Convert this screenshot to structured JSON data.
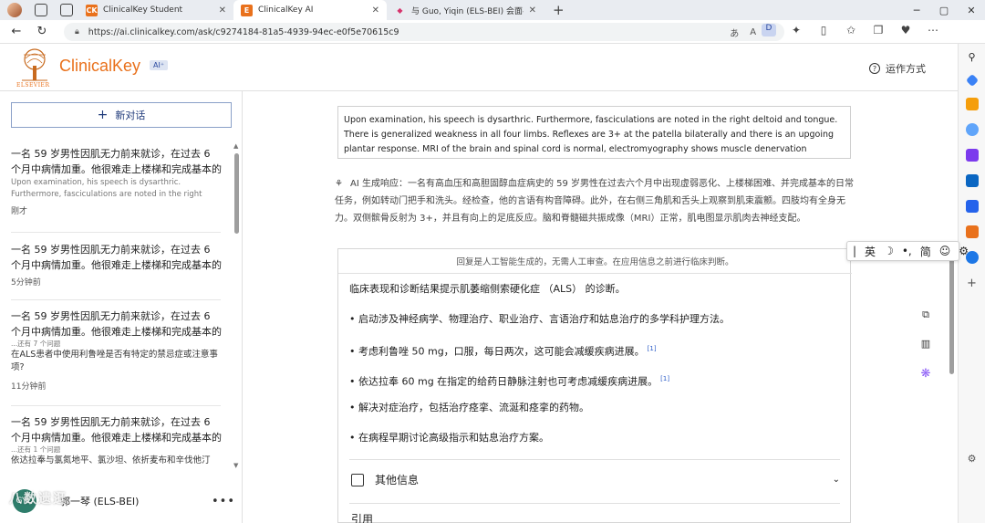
{
  "browser": {
    "tabs": [
      {
        "label": "ClinicalKey Student",
        "active": false,
        "favicon_color": "#e9711c",
        "favicon_glyph": "CK"
      },
      {
        "label": "ClinicalKey AI",
        "active": true,
        "favicon_color": "#e9711c",
        "favicon_glyph": "E"
      },
      {
        "label": "与 Guo, Yiqin (ELS-BEI) 会面-202...",
        "active": false,
        "favicon_color": "#d6336c",
        "favicon_glyph": "◆"
      }
    ],
    "url": "https://ai.clinicalkey.com/ask/c9274184-81a5-4939-94ec-e0f5e70615c9"
  },
  "header": {
    "brand": "ClinicalKey",
    "badge": "AI⁺",
    "publisher": "ELSEVIER",
    "howto": "运作方式"
  },
  "sidebar": {
    "new_chat": "新对话",
    "history": [
      {
        "question": "一名 59 岁男性因肌无力前来就诊，在过去 6 个月中病情加重。他很难走上楼梯和完成基本的",
        "sub1": "Upon examination, his speech is dysarthric.",
        "sub2": "Furthermore, fasciculations are noted in the right",
        "time": "刚才"
      },
      {
        "question": "一名 59 岁男性因肌无力前来就诊，在过去 6 个月中病情加重。他很难走上楼梯和完成基本的",
        "time": "5分钟前"
      },
      {
        "question": "一名 59 岁男性因肌无力前来就诊，在过去 6 个月中病情加重。他很难走上楼梯和完成基本的",
        "followups": "...还有 7 个问题",
        "extra": "在ALS患者中使用利鲁唑是否有特定的禁忌症或注意事项?",
        "time": "11分钟前"
      },
      {
        "question": "一名 59 岁男性因肌无力前来就诊，在过去 6 个月中病情加重。他很难走上楼梯和完成基本的",
        "followups": "...还有 1 个问题",
        "extra": "依达拉奉与氯氮地平、氯沙坦、依折麦布和辛伐他汀"
      }
    ],
    "user": {
      "initials": "GYQ",
      "name": "郭一琴 (ELS-BEI)",
      "more": "•••"
    }
  },
  "conversation": {
    "user_question": "Upon examination, his speech is dysarthric. Furthermore, fasciculations are noted in the right deltoid and tongue. There is generalized weakness in all four limbs. Reflexes are 3+ at the patella bilaterally and there is an upgoing plantar response. MRI of the brain and spinal cord is normal, electromyography shows muscle denervation",
    "ai_prefix": "AI 生成响应：",
    "ai_summary": "一名有高血压和高胆固醇血症病史的 59 岁男性在过去六个月中出现虚弱恶化、上楼梯困难、并完成基本的日常任务，例如转动门把手和洗头。经检查，他的言语有构音障碍。此外，在右侧三角肌和舌头上观察到肌束震颤。四肢均有全身无力。双侧髌骨反射为 3+，并且有向上的足底反应。脑和脊髓磁共振成像（MRI）正常，肌电图显示肌肉去神经支配。",
    "disclaimer": "回复是人工智能生成的，无需人工审查。在应用信息之前进行临床判断。",
    "answer_lines": [
      {
        "text": "临床表现和诊断结果提示肌萎缩侧索硬化症 （ALS） 的诊断。",
        "cite": ""
      },
      {
        "text": "• 启动涉及神经病学、物理治疗、职业治疗、言语治疗和姑息治疗的多学科护理方法。",
        "cite": ""
      },
      {
        "text": "• 考虑利鲁唑 50 mg，口服，每日两次，这可能会减缓疾病进展。",
        "cite": "[1]"
      },
      {
        "text": "• 依达拉奉 60 mg 在指定的给药日静脉注射也可考虑减缓疾病进展。",
        "cite": "[1]"
      },
      {
        "text": "• 解决对症治疗，包括治疗痉挛、流涎和痉挛的药物。",
        "cite": ""
      },
      {
        "text": "• 在病程早期讨论高级指示和姑息治疗方案。",
        "cite": ""
      }
    ],
    "more_info": "其他信息",
    "next_section": "引用"
  },
  "ime": {
    "items": [
      "英",
      "简"
    ]
  },
  "watermark": "八数遗逛"
}
